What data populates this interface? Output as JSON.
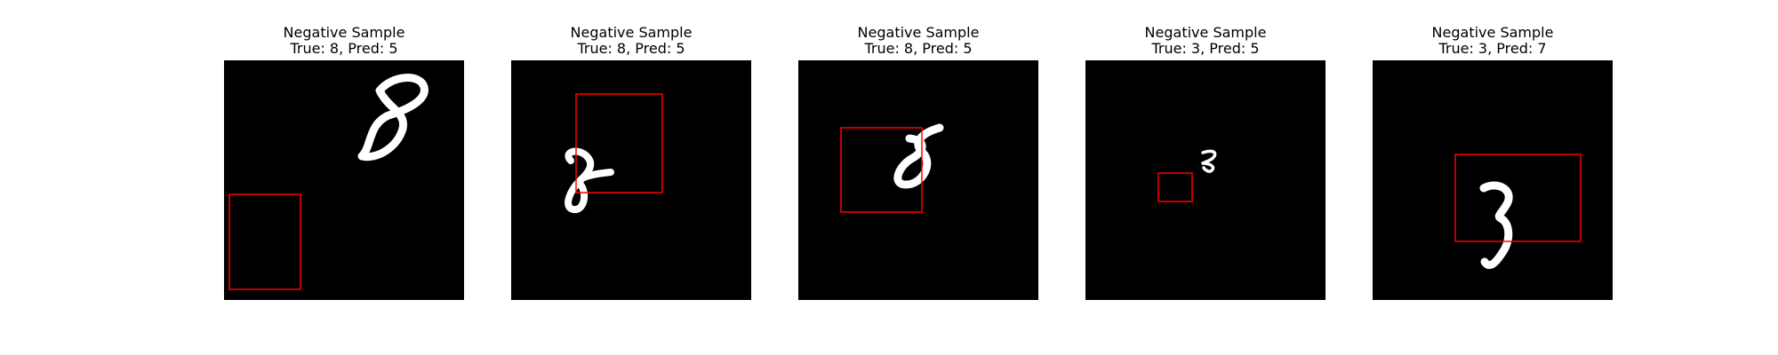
{
  "samples": [
    {
      "title": "Negative Sample",
      "subtitle": "True: 8, Pred: 5",
      "true_label": 8,
      "pred_label": 5,
      "digit_icon": "handwritten-8-icon",
      "box_color": "#ff0000"
    },
    {
      "title": "Negative Sample",
      "subtitle": "True: 8, Pred: 5",
      "true_label": 8,
      "pred_label": 5,
      "digit_icon": "handwritten-8-icon",
      "box_color": "#ff0000"
    },
    {
      "title": "Negative Sample",
      "subtitle": "True: 8, Pred: 5",
      "true_label": 8,
      "pred_label": 5,
      "digit_icon": "handwritten-8-icon",
      "box_color": "#ff0000"
    },
    {
      "title": "Negative Sample",
      "subtitle": "True: 3, Pred: 5",
      "true_label": 3,
      "pred_label": 5,
      "digit_icon": "handwritten-3-icon",
      "box_color": "#ff0000"
    },
    {
      "title": "Negative Sample",
      "subtitle": "True: 3, Pred: 7",
      "true_label": 3,
      "pred_label": 7,
      "digit_icon": "handwritten-3-icon",
      "box_color": "#ff0000"
    }
  ]
}
